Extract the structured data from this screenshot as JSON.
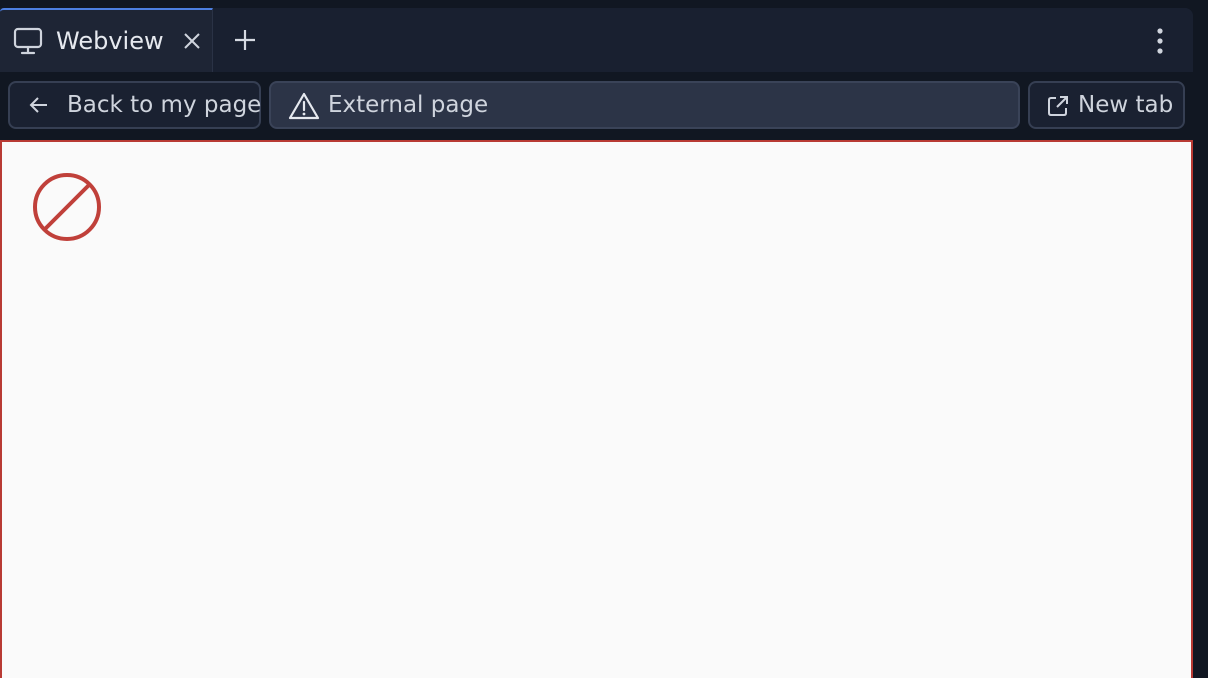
{
  "tab": {
    "title": "Webview",
    "icon": "monitor-icon",
    "active_indicator_color": "#4d7fe0"
  },
  "toolbar": {
    "back_label": "Back to my page",
    "url_label": "External page",
    "url_icon": "warning-icon",
    "new_tab_label": "New tab"
  },
  "content": {
    "icon": "blocked-icon",
    "border_color": "#b83a34",
    "icon_color": "#c0403a"
  }
}
